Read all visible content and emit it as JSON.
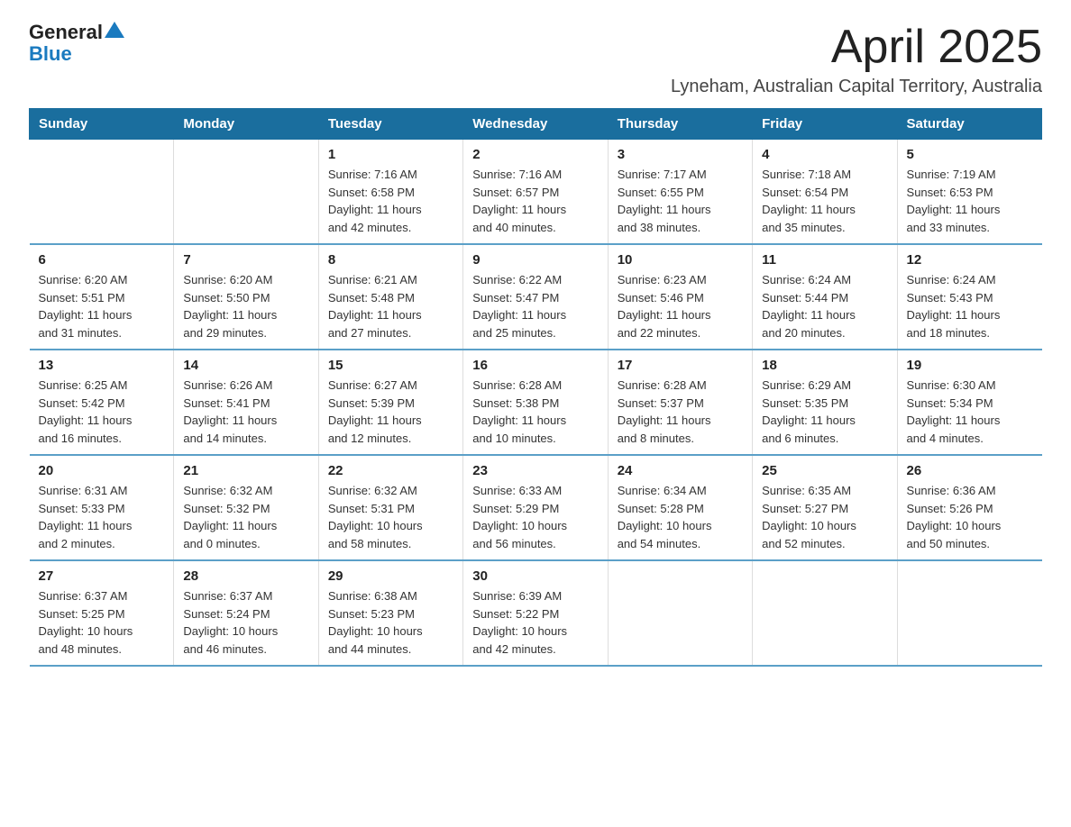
{
  "logo": {
    "text_general": "General",
    "text_blue": "Blue"
  },
  "title": "April 2025",
  "subtitle": "Lyneham, Australian Capital Territory, Australia",
  "days_of_week": [
    "Sunday",
    "Monday",
    "Tuesday",
    "Wednesday",
    "Thursday",
    "Friday",
    "Saturday"
  ],
  "weeks": [
    [
      {
        "day": "",
        "info": ""
      },
      {
        "day": "",
        "info": ""
      },
      {
        "day": "1",
        "info": "Sunrise: 7:16 AM\nSunset: 6:58 PM\nDaylight: 11 hours\nand 42 minutes."
      },
      {
        "day": "2",
        "info": "Sunrise: 7:16 AM\nSunset: 6:57 PM\nDaylight: 11 hours\nand 40 minutes."
      },
      {
        "day": "3",
        "info": "Sunrise: 7:17 AM\nSunset: 6:55 PM\nDaylight: 11 hours\nand 38 minutes."
      },
      {
        "day": "4",
        "info": "Sunrise: 7:18 AM\nSunset: 6:54 PM\nDaylight: 11 hours\nand 35 minutes."
      },
      {
        "day": "5",
        "info": "Sunrise: 7:19 AM\nSunset: 6:53 PM\nDaylight: 11 hours\nand 33 minutes."
      }
    ],
    [
      {
        "day": "6",
        "info": "Sunrise: 6:20 AM\nSunset: 5:51 PM\nDaylight: 11 hours\nand 31 minutes."
      },
      {
        "day": "7",
        "info": "Sunrise: 6:20 AM\nSunset: 5:50 PM\nDaylight: 11 hours\nand 29 minutes."
      },
      {
        "day": "8",
        "info": "Sunrise: 6:21 AM\nSunset: 5:48 PM\nDaylight: 11 hours\nand 27 minutes."
      },
      {
        "day": "9",
        "info": "Sunrise: 6:22 AM\nSunset: 5:47 PM\nDaylight: 11 hours\nand 25 minutes."
      },
      {
        "day": "10",
        "info": "Sunrise: 6:23 AM\nSunset: 5:46 PM\nDaylight: 11 hours\nand 22 minutes."
      },
      {
        "day": "11",
        "info": "Sunrise: 6:24 AM\nSunset: 5:44 PM\nDaylight: 11 hours\nand 20 minutes."
      },
      {
        "day": "12",
        "info": "Sunrise: 6:24 AM\nSunset: 5:43 PM\nDaylight: 11 hours\nand 18 minutes."
      }
    ],
    [
      {
        "day": "13",
        "info": "Sunrise: 6:25 AM\nSunset: 5:42 PM\nDaylight: 11 hours\nand 16 minutes."
      },
      {
        "day": "14",
        "info": "Sunrise: 6:26 AM\nSunset: 5:41 PM\nDaylight: 11 hours\nand 14 minutes."
      },
      {
        "day": "15",
        "info": "Sunrise: 6:27 AM\nSunset: 5:39 PM\nDaylight: 11 hours\nand 12 minutes."
      },
      {
        "day": "16",
        "info": "Sunrise: 6:28 AM\nSunset: 5:38 PM\nDaylight: 11 hours\nand 10 minutes."
      },
      {
        "day": "17",
        "info": "Sunrise: 6:28 AM\nSunset: 5:37 PM\nDaylight: 11 hours\nand 8 minutes."
      },
      {
        "day": "18",
        "info": "Sunrise: 6:29 AM\nSunset: 5:35 PM\nDaylight: 11 hours\nand 6 minutes."
      },
      {
        "day": "19",
        "info": "Sunrise: 6:30 AM\nSunset: 5:34 PM\nDaylight: 11 hours\nand 4 minutes."
      }
    ],
    [
      {
        "day": "20",
        "info": "Sunrise: 6:31 AM\nSunset: 5:33 PM\nDaylight: 11 hours\nand 2 minutes."
      },
      {
        "day": "21",
        "info": "Sunrise: 6:32 AM\nSunset: 5:32 PM\nDaylight: 11 hours\nand 0 minutes."
      },
      {
        "day": "22",
        "info": "Sunrise: 6:32 AM\nSunset: 5:31 PM\nDaylight: 10 hours\nand 58 minutes."
      },
      {
        "day": "23",
        "info": "Sunrise: 6:33 AM\nSunset: 5:29 PM\nDaylight: 10 hours\nand 56 minutes."
      },
      {
        "day": "24",
        "info": "Sunrise: 6:34 AM\nSunset: 5:28 PM\nDaylight: 10 hours\nand 54 minutes."
      },
      {
        "day": "25",
        "info": "Sunrise: 6:35 AM\nSunset: 5:27 PM\nDaylight: 10 hours\nand 52 minutes."
      },
      {
        "day": "26",
        "info": "Sunrise: 6:36 AM\nSunset: 5:26 PM\nDaylight: 10 hours\nand 50 minutes."
      }
    ],
    [
      {
        "day": "27",
        "info": "Sunrise: 6:37 AM\nSunset: 5:25 PM\nDaylight: 10 hours\nand 48 minutes."
      },
      {
        "day": "28",
        "info": "Sunrise: 6:37 AM\nSunset: 5:24 PM\nDaylight: 10 hours\nand 46 minutes."
      },
      {
        "day": "29",
        "info": "Sunrise: 6:38 AM\nSunset: 5:23 PM\nDaylight: 10 hours\nand 44 minutes."
      },
      {
        "day": "30",
        "info": "Sunrise: 6:39 AM\nSunset: 5:22 PM\nDaylight: 10 hours\nand 42 minutes."
      },
      {
        "day": "",
        "info": ""
      },
      {
        "day": "",
        "info": ""
      },
      {
        "day": "",
        "info": ""
      }
    ]
  ]
}
